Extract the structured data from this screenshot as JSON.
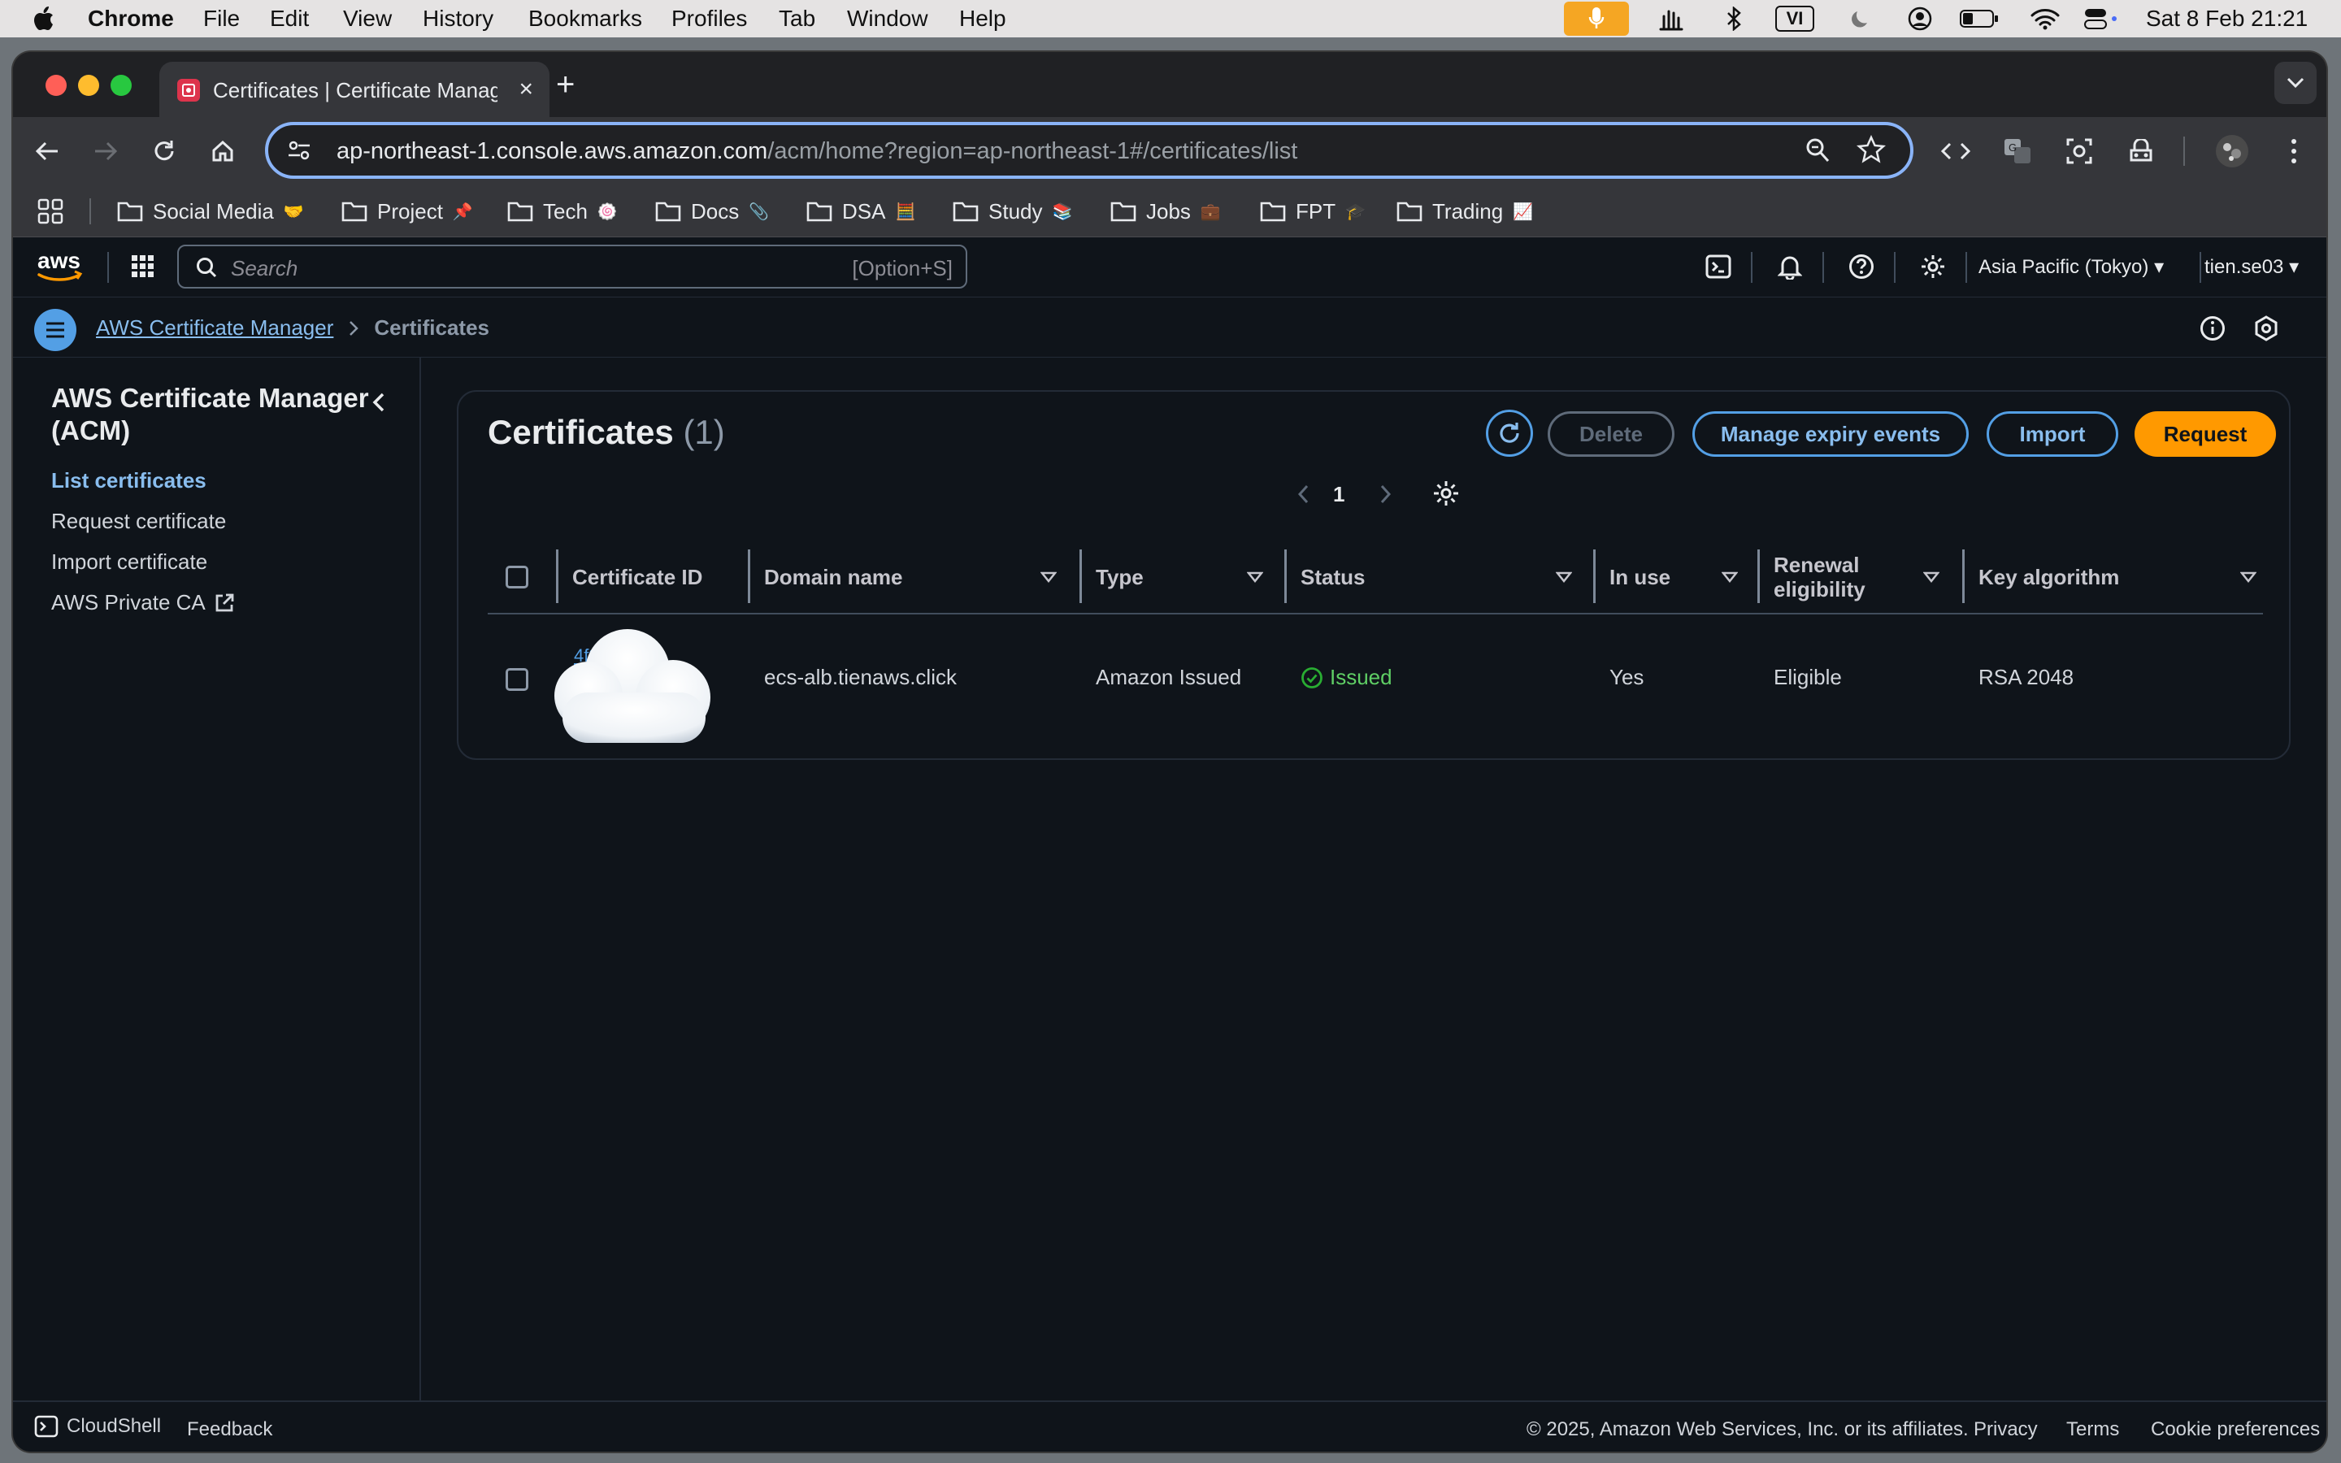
{
  "menubar": {
    "app": "Chrome",
    "items": [
      "File",
      "Edit",
      "View",
      "History",
      "Bookmarks",
      "Profiles",
      "Tab",
      "Window",
      "Help"
    ],
    "keyboard_indicator": "VI",
    "datetime": "Sat 8 Feb  21:21"
  },
  "browser": {
    "tab_title": "Certificates | Certificate Manager",
    "url_host": "ap-northeast-1.console.aws.amazon.com",
    "url_path": "/acm/home?region=ap-northeast-1#/certificates/list",
    "bookmarks": [
      {
        "label": "Social Media",
        "emoji": "🤝"
      },
      {
        "label": "Project",
        "emoji": "📌"
      },
      {
        "label": "Tech",
        "emoji": "🍥"
      },
      {
        "label": "Docs",
        "emoji": "📎"
      },
      {
        "label": "DSA",
        "emoji": "🧮"
      },
      {
        "label": "Study",
        "emoji": "📚"
      },
      {
        "label": "Jobs",
        "emoji": "💼"
      },
      {
        "label": "FPT",
        "emoji": "🎓"
      },
      {
        "label": "Trading",
        "emoji": "📈"
      }
    ]
  },
  "aws_nav": {
    "logo": "aws",
    "search_placeholder": "Search",
    "search_shortcut": "[Option+S]",
    "region": "Asia Pacific (Tokyo)",
    "user": "tien.se03"
  },
  "breadcrumb": {
    "service": "AWS Certificate Manager",
    "current": "Certificates"
  },
  "sidebar": {
    "title": "AWS Certificate Manager (ACM)",
    "items": [
      {
        "label": "List certificates",
        "active": true
      },
      {
        "label": "Request certificate",
        "active": false
      },
      {
        "label": "Import certificate",
        "active": false
      },
      {
        "label": "AWS Private CA",
        "active": false,
        "external": true
      }
    ]
  },
  "panel": {
    "title": "Certificates",
    "count": "(1)",
    "buttons": {
      "delete": "Delete",
      "manage": "Manage expiry events",
      "import": "Import",
      "request": "Request"
    },
    "page": "1",
    "columns": [
      "Certificate ID",
      "Domain name",
      "Type",
      "Status",
      "In use",
      "Renewal eligibility",
      "Key algorithm"
    ],
    "rows": [
      {
        "certificate_id": "4f9",
        "domain_name": "ecs-alb.tienaws.click",
        "type": "Amazon Issued",
        "status": "Issued",
        "in_use": "Yes",
        "renewal": "Eligible",
        "key_algorithm": "RSA 2048"
      }
    ]
  },
  "footer": {
    "cloudshell": "CloudShell",
    "feedback": "Feedback",
    "copyright": "© 2025, Amazon Web Services, Inc. or its affiliates.",
    "privacy": "Privacy",
    "terms": "Terms",
    "cookies": "Cookie preferences"
  },
  "colors": {
    "aws_bg": "#0f141a",
    "link": "#539fe5",
    "primary": "#ff9900",
    "success": "#29ad32",
    "omnibox_focus": "#8ab4f8"
  }
}
